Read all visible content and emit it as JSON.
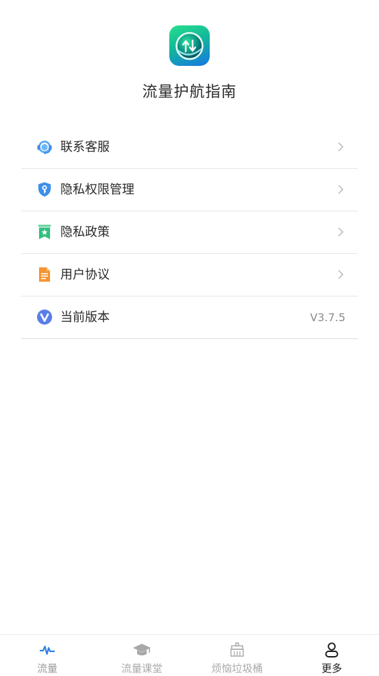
{
  "header": {
    "app_title": "流量护航指南",
    "logo_icon": "traffic-arrows-logo-icon"
  },
  "menu": {
    "items": [
      {
        "label": "联系客服",
        "icon": "headset-icon"
      },
      {
        "label": "隐私权限管理",
        "icon": "key-shield-icon"
      },
      {
        "label": "隐私政策",
        "icon": "bookmark-star-icon"
      },
      {
        "label": "用户协议",
        "icon": "document-icon"
      },
      {
        "label": "当前版本",
        "icon": "v-badge-icon",
        "value": "V3.7.5"
      }
    ]
  },
  "tab_bar": {
    "tabs": [
      {
        "label": "流量",
        "icon": "pulse-icon",
        "active": false
      },
      {
        "label": "流量课堂",
        "icon": "graduation-cap-icon",
        "active": false
      },
      {
        "label": "烦恼垃圾桶",
        "icon": "trash-bin-icon",
        "active": false
      },
      {
        "label": "更多",
        "icon": "person-icon",
        "active": true
      }
    ]
  },
  "colors": {
    "accent_blue": "#2f7fe8",
    "logo_green": "#27e08d",
    "logo_blue": "#1776e6",
    "inactive_tab": "#a9a9a9",
    "active_tab": "#1a1a1a"
  }
}
